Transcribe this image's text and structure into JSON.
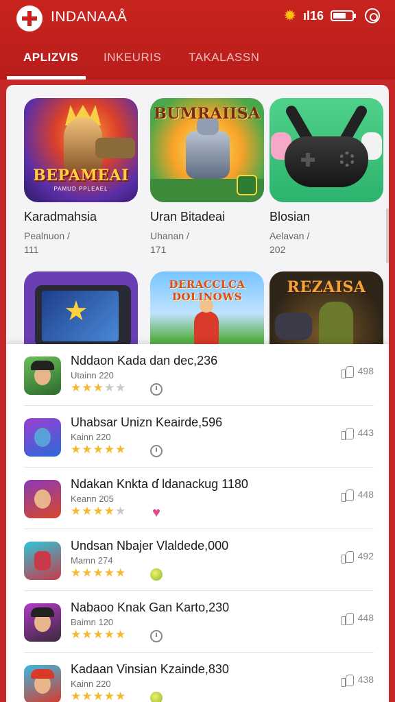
{
  "header": {
    "title": "INDANAAÅ",
    "signal_text": "ıl16",
    "battery_level": 0.7
  },
  "tabs": [
    {
      "label": "APLIZVIS",
      "active": true
    },
    {
      "label": "INKEURIS",
      "active": false
    },
    {
      "label": "TAKALASSN",
      "active": false
    }
  ],
  "featured": [
    {
      "name": "Karadmahsia",
      "meta1": "Pealnuon /",
      "meta2": "111",
      "art_title": "BEPAMEAI",
      "art_subtitle": "PAMUD PPLEAEL"
    },
    {
      "name": "Uran Bitadeai",
      "meta1": "Uhanan /",
      "meta2": "171",
      "art_title": "BUMRAIISA"
    },
    {
      "name": "Blosian",
      "meta1": "Aelavan /",
      "meta2": "202"
    },
    {
      "art_title": ""
    },
    {
      "art_title": "DERACCLCA DOLINOWS"
    },
    {
      "art_title": "REZAISA"
    }
  ],
  "list": [
    {
      "title": "Nddaon Kada dan dec,236",
      "subtitle": "Utainn 220",
      "rating": 2.5,
      "status_icon": "clock-icon",
      "likes": "498"
    },
    {
      "title": "Uhabsar Unizn Keairde,596",
      "subtitle": "Kainn 220",
      "rating": 4.5,
      "status_icon": "clock-icon",
      "likes": "443"
    },
    {
      "title": "Ndakan Knkta ɗ ldanackug 1180",
      "subtitle": "Keann 205",
      "rating": 3.5,
      "status_icon": "heart-icon",
      "likes": "448"
    },
    {
      "title": "Undsan Nbajer Vlaldede,000",
      "subtitle": "Mamn 274",
      "rating": 4.5,
      "status_icon": "coin-icon",
      "likes": "492"
    },
    {
      "title": "Nabaoo Knak Gan Karto,230",
      "subtitle": "Baimn 120",
      "rating": 4.5,
      "status_icon": "clock-icon",
      "likes": "448"
    },
    {
      "title": "Kadaan Vinsian Kzainde,830",
      "subtitle": "Kainn 220",
      "rating": 4.5,
      "status_icon": "coin-icon",
      "likes": "438"
    }
  ],
  "colors": {
    "brand_red": "#c8241f",
    "star_gold": "#f5b82e",
    "sheet_bg": "#f4f4f6"
  }
}
